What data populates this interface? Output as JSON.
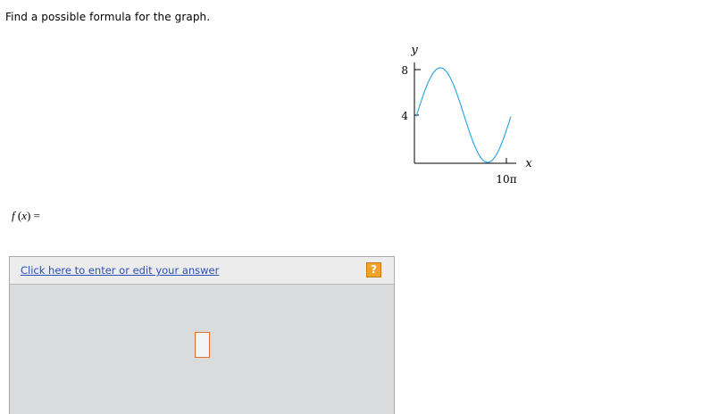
{
  "question": {
    "prompt": "Find a possible formula for the graph."
  },
  "graph": {
    "y_axis_label": "y",
    "x_axis_label": "x",
    "y_ticks": [
      "8",
      "4"
    ],
    "x_tick": "10π",
    "curve_color": "#35a7e0"
  },
  "answer": {
    "fx_name": "f",
    "fx_open": " (",
    "fx_var": "x",
    "fx_close": ") =",
    "edit_link": "Click here to enter or edit your answer",
    "help_label": "?"
  },
  "colors": {
    "panel_bg": "#d9dbdd",
    "link": "#2b4fb8",
    "help_button": "#f2a12c",
    "cursor_box": "#e0712a"
  }
}
